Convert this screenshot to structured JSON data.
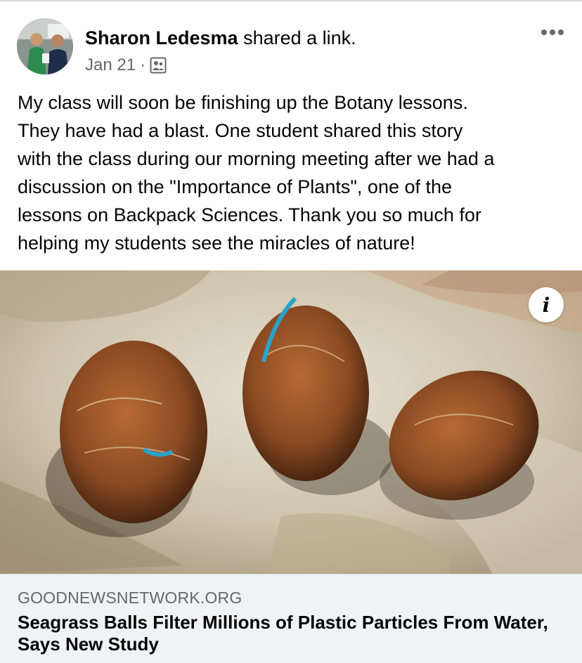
{
  "post": {
    "author": "Sharon Ledesma",
    "action_text": " shared a link.",
    "date": "Jan 21",
    "separator": "·",
    "audience_icon": "group-audience-icon",
    "more_icon": "more-options-icon",
    "text_lines": [
      "My class will soon be finishing up the Botany lessons.",
      "They have had a blast.  One student shared this story",
      "with the class during our morning meeting after we had a",
      "discussion on the \"Importance of Plants\", one of the",
      "lessons on Backpack Sciences.  Thank you so much for",
      "helping my students see the miracles of nature!"
    ]
  },
  "link_preview": {
    "info_glyph": "i",
    "domain": "GOODNEWSNETWORK.ORG",
    "title": "Seagrass Balls Filter Millions of Plastic Particles From Water, Says New Study"
  },
  "colors": {
    "text_primary": "#050505",
    "text_secondary": "#65676b",
    "card_background": "#f0f2f5"
  }
}
